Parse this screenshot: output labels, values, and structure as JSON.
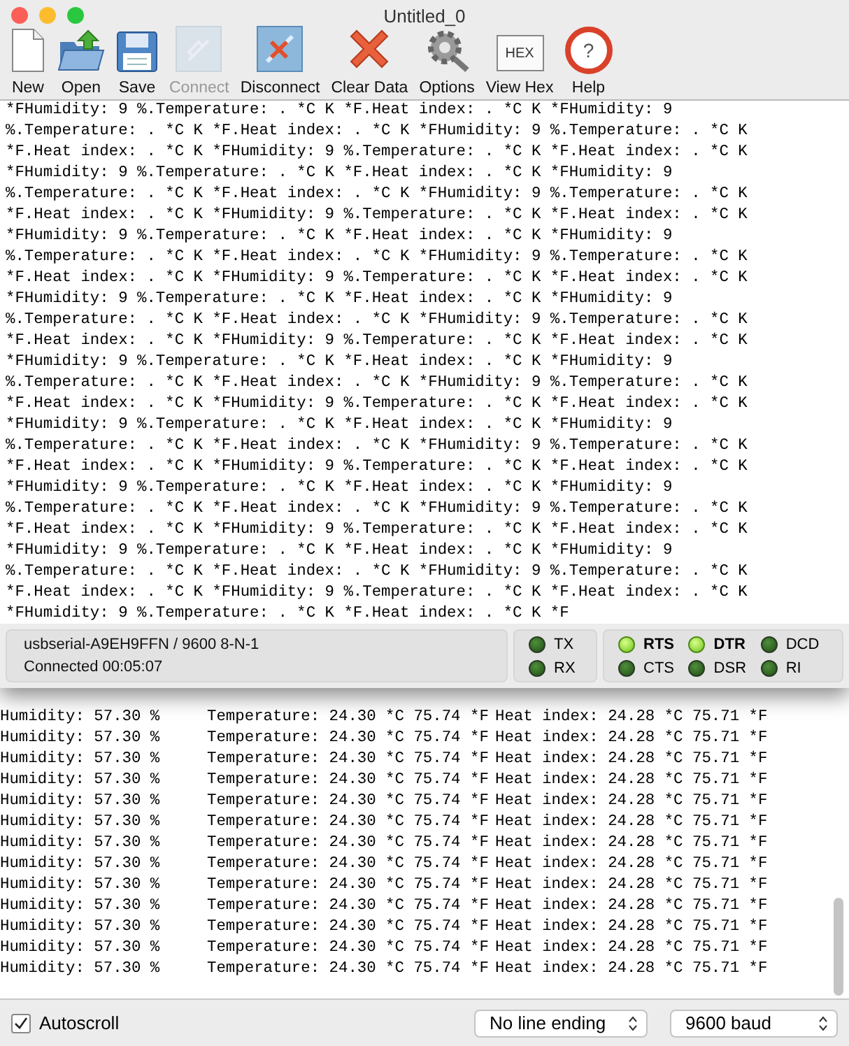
{
  "window": {
    "title": "Untitled_0"
  },
  "toolbar": [
    {
      "label": "New",
      "kind": "new",
      "disabled": false
    },
    {
      "label": "Open",
      "kind": "open",
      "disabled": false
    },
    {
      "label": "Save",
      "kind": "save",
      "disabled": false
    },
    {
      "label": "Connect",
      "kind": "connect",
      "disabled": true
    },
    {
      "label": "Disconnect",
      "kind": "disconnect",
      "disabled": false
    },
    {
      "label": "Clear Data",
      "kind": "clear",
      "disabled": false
    },
    {
      "label": "Options",
      "kind": "options",
      "disabled": false
    },
    {
      "label": "View Hex",
      "kind": "hex",
      "icon_text": "HEX",
      "disabled": false
    },
    {
      "label": "Help",
      "kind": "help",
      "icon_text": "?",
      "disabled": false
    }
  ],
  "terminal": {
    "lines": [
      "*FHumidity: 9 %.Temperature: . *C K *F.Heat index: . *C K *FHumidity: 9",
      "%.Temperature: . *C K *F.Heat index: . *C K *FHumidity: 9 %.Temperature: . *C K",
      "*F.Heat index: . *C K *FHumidity: 9 %.Temperature: . *C K *F.Heat index: . *C K",
      "*FHumidity: 9 %.Temperature: . *C K *F.Heat index: . *C K *FHumidity: 9",
      "%.Temperature: . *C K *F.Heat index: . *C K *FHumidity: 9 %.Temperature: . *C K",
      "*F.Heat index: . *C K *FHumidity: 9 %.Temperature: . *C K *F.Heat index: . *C K",
      "*FHumidity: 9 %.Temperature: . *C K *F.Heat index: . *C K *FHumidity: 9",
      "%.Temperature: . *C K *F.Heat index: . *C K *FHumidity: 9 %.Temperature: . *C K",
      "*F.Heat index: . *C K *FHumidity: 9 %.Temperature: . *C K *F.Heat index: . *C K",
      "*FHumidity: 9 %.Temperature: . *C K *F.Heat index: . *C K *FHumidity: 9",
      "%.Temperature: . *C K *F.Heat index: . *C K *FHumidity: 9 %.Temperature: . *C K",
      "*F.Heat index: . *C K *FHumidity: 9 %.Temperature: . *C K *F.Heat index: . *C K",
      "*FHumidity: 9 %.Temperature: . *C K *F.Heat index: . *C K *FHumidity: 9",
      "%.Temperature: . *C K *F.Heat index: . *C K *FHumidity: 9 %.Temperature: . *C K",
      "*F.Heat index: . *C K *FHumidity: 9 %.Temperature: . *C K *F.Heat index: . *C K",
      "*FHumidity: 9 %.Temperature: . *C K *F.Heat index: . *C K *FHumidity: 9",
      "%.Temperature: . *C K *F.Heat index: . *C K *FHumidity: 9 %.Temperature: . *C K",
      "*F.Heat index: . *C K *FHumidity: 9 %.Temperature: . *C K *F.Heat index: . *C K",
      "*FHumidity: 9 %.Temperature: . *C K *F.Heat index: . *C K *FHumidity: 9",
      "%.Temperature: . *C K *F.Heat index: . *C K *FHumidity: 9 %.Temperature: . *C K",
      "*F.Heat index: . *C K *FHumidity: 9 %.Temperature: . *C K *F.Heat index: . *C K",
      "*FHumidity: 9 %.Temperature: . *C K *F.Heat index: . *C K *FHumidity: 9",
      "%.Temperature: . *C K *F.Heat index: . *C K *FHumidity: 9 %.Temperature: . *C K",
      "*F.Heat index: . *C K *FHumidity: 9 %.Temperature: . *C K *F.Heat index: . *C K",
      "*FHumidity: 9 %.Temperature: . *C K *F.Heat index: . *C K *F"
    ]
  },
  "status_bar": {
    "port": "usbserial-A9EH9FFN / 9600 8-N-1",
    "connection": "Connected 00:05:07",
    "data_leds": [
      {
        "label": "TX",
        "on": false
      },
      {
        "label": "RX",
        "on": false
      }
    ],
    "line_leds": [
      {
        "label": "RTS",
        "on": true
      },
      {
        "label": "DTR",
        "on": true
      },
      {
        "label": "DCD",
        "on": false
      },
      {
        "label": "CTS",
        "on": false
      },
      {
        "label": "DSR",
        "on": false
      },
      {
        "label": "RI",
        "on": false
      }
    ]
  },
  "serial_monitor": {
    "rows": [
      {
        "humidity": "Humidity: 57.30 %",
        "temperature": "Temperature: 24.30 *C 75.74 *F",
        "heat_index": "Heat index: 24.28 *C 75.71 *F"
      },
      {
        "humidity": "Humidity: 57.30 %",
        "temperature": "Temperature: 24.30 *C 75.74 *F",
        "heat_index": "Heat index: 24.28 *C 75.71 *F"
      },
      {
        "humidity": "Humidity: 57.30 %",
        "temperature": "Temperature: 24.30 *C 75.74 *F",
        "heat_index": "Heat index: 24.28 *C 75.71 *F"
      },
      {
        "humidity": "Humidity: 57.30 %",
        "temperature": "Temperature: 24.30 *C 75.74 *F",
        "heat_index": "Heat index: 24.28 *C 75.71 *F"
      },
      {
        "humidity": "Humidity: 57.30 %",
        "temperature": "Temperature: 24.30 *C 75.74 *F",
        "heat_index": "Heat index: 24.28 *C 75.71 *F"
      },
      {
        "humidity": "Humidity: 57.30 %",
        "temperature": "Temperature: 24.30 *C 75.74 *F",
        "heat_index": "Heat index: 24.28 *C 75.71 *F"
      },
      {
        "humidity": "Humidity: 57.30 %",
        "temperature": "Temperature: 24.30 *C 75.74 *F",
        "heat_index": "Heat index: 24.28 *C 75.71 *F"
      },
      {
        "humidity": "Humidity: 57.30 %",
        "temperature": "Temperature: 24.30 *C 75.74 *F",
        "heat_index": "Heat index: 24.28 *C 75.71 *F"
      },
      {
        "humidity": "Humidity: 57.30 %",
        "temperature": "Temperature: 24.30 *C 75.74 *F",
        "heat_index": "Heat index: 24.28 *C 75.71 *F"
      },
      {
        "humidity": "Humidity: 57.30 %",
        "temperature": "Temperature: 24.30 *C 75.74 *F",
        "heat_index": "Heat index: 24.28 *C 75.71 *F"
      },
      {
        "humidity": "Humidity: 57.30 %",
        "temperature": "Temperature: 24.30 *C 75.74 *F",
        "heat_index": "Heat index: 24.28 *C 75.71 *F"
      },
      {
        "humidity": "Humidity: 57.30 %",
        "temperature": "Temperature: 24.30 *C 75.74 *F",
        "heat_index": "Heat index: 24.28 *C 75.71 *F"
      },
      {
        "humidity": "Humidity: 57.30 %",
        "temperature": "Temperature: 24.30 *C 75.74 *F",
        "heat_index": "Heat index: 24.28 *C 75.71 *F"
      }
    ],
    "autoscroll": {
      "label": "Autoscroll",
      "checked": true
    },
    "line_ending": "No line ending",
    "baud": "9600 baud"
  }
}
